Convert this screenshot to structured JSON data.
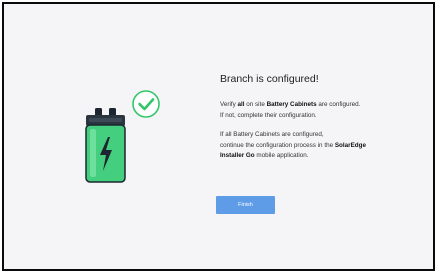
{
  "title": "Branch is configured!",
  "paragraph1": {
    "line1_prefix": "Verify ",
    "line1_bold1": "all",
    "line1_mid": " on site ",
    "line1_bold2": "Battery Cabinets",
    "line1_suffix": " are configured.",
    "line2": "If not, complete their configuration."
  },
  "paragraph2": {
    "line1": "If all Battery Cabinets are configured,",
    "line2_prefix": "continue the configuration process in the ",
    "line2_bold": "SolarEdge",
    "line3_bold": "Installer Go",
    "line3_suffix": " mobile application."
  },
  "finish_button": {
    "label": "Finish"
  },
  "colors": {
    "accent": "#5e9ce8",
    "battery_green": "#43cf7e",
    "check_green": "#31c769",
    "battery_top": "#1d2630"
  },
  "icons": {
    "illustration": "battery-icon",
    "status": "check-circle-icon"
  }
}
